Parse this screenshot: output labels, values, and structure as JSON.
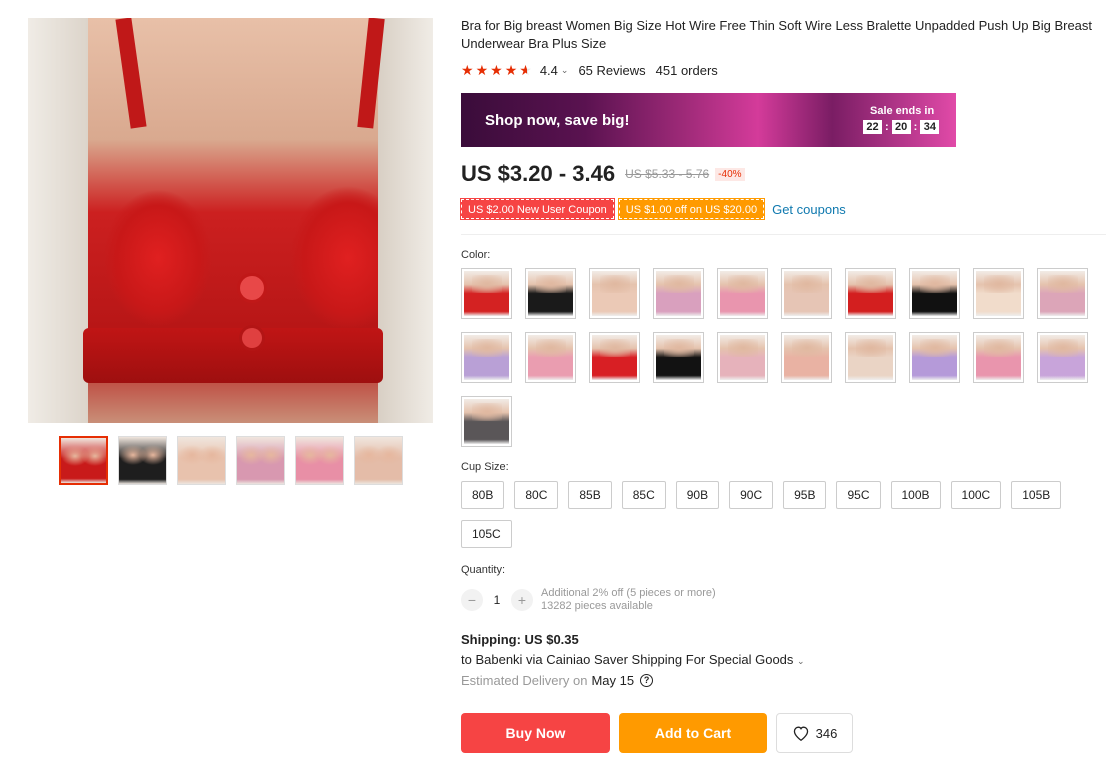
{
  "product": {
    "title": "Bra for Big breast Women Big Size Hot Wire Free Thin Soft Wire Less Bralette Unpadded Push Up Big Breast Underwear Bra Plus Size",
    "rating": "4.4",
    "reviews": "65 Reviews",
    "orders": "451 orders"
  },
  "gallery": {
    "thumbnails": [
      {
        "color": "#c81a1a"
      },
      {
        "color": "#1e1e1e"
      },
      {
        "color": "#e8c2ad"
      },
      {
        "color": "#d898b0"
      },
      {
        "color": "#e88fa6"
      },
      {
        "color": "#e4bca8"
      }
    ]
  },
  "banner": {
    "text": "Shop now, save big!",
    "sale_label": "Sale ends in",
    "timer": {
      "h": "22",
      "m": "20",
      "s": "34"
    }
  },
  "pricing": {
    "price": "US $3.20 - 3.46",
    "old_price": "US $5.33 - 5.76",
    "discount": "-40%"
  },
  "coupons": {
    "new_user": "US $2.00 New User Coupon",
    "off": "US $1.00 off on US $20.00",
    "get_coupons": "Get coupons"
  },
  "color": {
    "label": "Color:",
    "swatches": [
      "#d42222",
      "#1a1a1a",
      "#ebc9b6",
      "#d9a0be",
      "#e995ae",
      "#e6c5b5",
      "#d31f1f",
      "#111111",
      "#f1dccb",
      "#dca5b8",
      "#b9a0d6",
      "#ea9db0",
      "#d81f24",
      "#121212",
      "#e6b2bb",
      "#e9b2a3",
      "#ead4c5",
      "#b59ad9",
      "#e995ad",
      "#c8a4da",
      "#5a5658"
    ]
  },
  "cup_size": {
    "label": "Cup Size:",
    "options": [
      "80B",
      "80C",
      "85B",
      "85C",
      "90B",
      "90C",
      "95B",
      "95C",
      "100B",
      "100C",
      "105B",
      "105C"
    ]
  },
  "quantity": {
    "label": "Quantity:",
    "value": "1",
    "minus": "−",
    "plus": "+",
    "discount_note": "Additional 2% off (5 pieces or more)",
    "available": "13282 pieces available"
  },
  "shipping": {
    "title": "Shipping: US $0.35",
    "line": "to Babenki via Cainiao Saver Shipping For Special Goods",
    "delivery_prefix": "Estimated Delivery on",
    "delivery_date": "May 15"
  },
  "actions": {
    "buy_now": "Buy Now",
    "add_to_cart": "Add to Cart",
    "wishlist_count": "346"
  }
}
